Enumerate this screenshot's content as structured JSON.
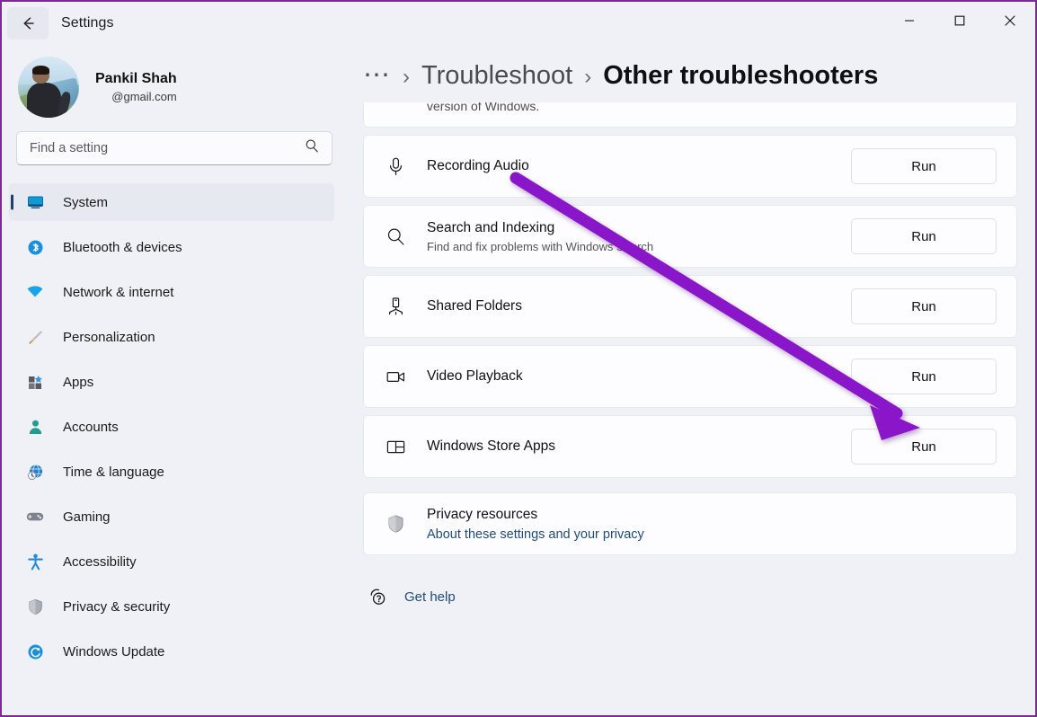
{
  "window": {
    "title": "Settings",
    "back_icon": "back-arrow-icon",
    "minimize_label": "—",
    "maximize_label": "□",
    "close_label": "✕"
  },
  "sidebar": {
    "profile": {
      "name": "Pankil Shah",
      "email": "@gmail.com",
      "avatar": "user-avatar-photo"
    },
    "search": {
      "placeholder": "Find a setting",
      "value": "",
      "icon": "search-icon"
    },
    "items": [
      {
        "label": "System",
        "icon": "system-monitor-icon",
        "selected": true
      },
      {
        "label": "Bluetooth & devices",
        "icon": "bluetooth-icon",
        "selected": false
      },
      {
        "label": "Network & internet",
        "icon": "wifi-icon",
        "selected": false
      },
      {
        "label": "Personalization",
        "icon": "paintbrush-icon",
        "selected": false
      },
      {
        "label": "Apps",
        "icon": "apps-grid-icon",
        "selected": false
      },
      {
        "label": "Accounts",
        "icon": "person-icon",
        "selected": false
      },
      {
        "label": "Time & language",
        "icon": "clock-globe-icon",
        "selected": false
      },
      {
        "label": "Gaming",
        "icon": "gamepad-icon",
        "selected": false
      },
      {
        "label": "Accessibility",
        "icon": "accessibility-person-icon",
        "selected": false
      },
      {
        "label": "Privacy & security",
        "icon": "shield-icon",
        "selected": false
      },
      {
        "label": "Windows Update",
        "icon": "update-refresh-icon",
        "selected": false
      }
    ]
  },
  "breadcrumb": {
    "overflow": "⋯",
    "separator": "›",
    "parent": "Troubleshoot",
    "current": "Other troubleshooters"
  },
  "main": {
    "partial_card_text": "version of Windows.",
    "troubleshooters": [
      {
        "title": "Recording Audio",
        "subtitle": "",
        "icon": "microphone-icon",
        "action": "Run"
      },
      {
        "title": "Search and Indexing",
        "subtitle": "Find and fix problems with Windows Search",
        "icon": "search-icon",
        "action": "Run"
      },
      {
        "title": "Shared Folders",
        "subtitle": "",
        "icon": "shared-folders-icon",
        "action": "Run"
      },
      {
        "title": "Video Playback",
        "subtitle": "",
        "icon": "video-camera-icon",
        "action": "Run"
      },
      {
        "title": "Windows Store Apps",
        "subtitle": "",
        "icon": "store-apps-icon",
        "action": "Run"
      }
    ],
    "privacy_card": {
      "title": "Privacy resources",
      "link": "About these settings and your privacy",
      "icon": "shield-icon"
    },
    "get_help": {
      "label": "Get help",
      "icon": "help-question-icon"
    }
  },
  "annotation": {
    "type": "arrow",
    "color": "#8a17c9",
    "points_to": "Video Playback Run button"
  },
  "colors": {
    "window_border": "#7b2d8e",
    "page_background": "#eff1f7",
    "card_background": "#fdfdff",
    "accent_selection": "#1f3f6e",
    "link": "#1f4a7a",
    "annotation": "#8a17c9"
  }
}
